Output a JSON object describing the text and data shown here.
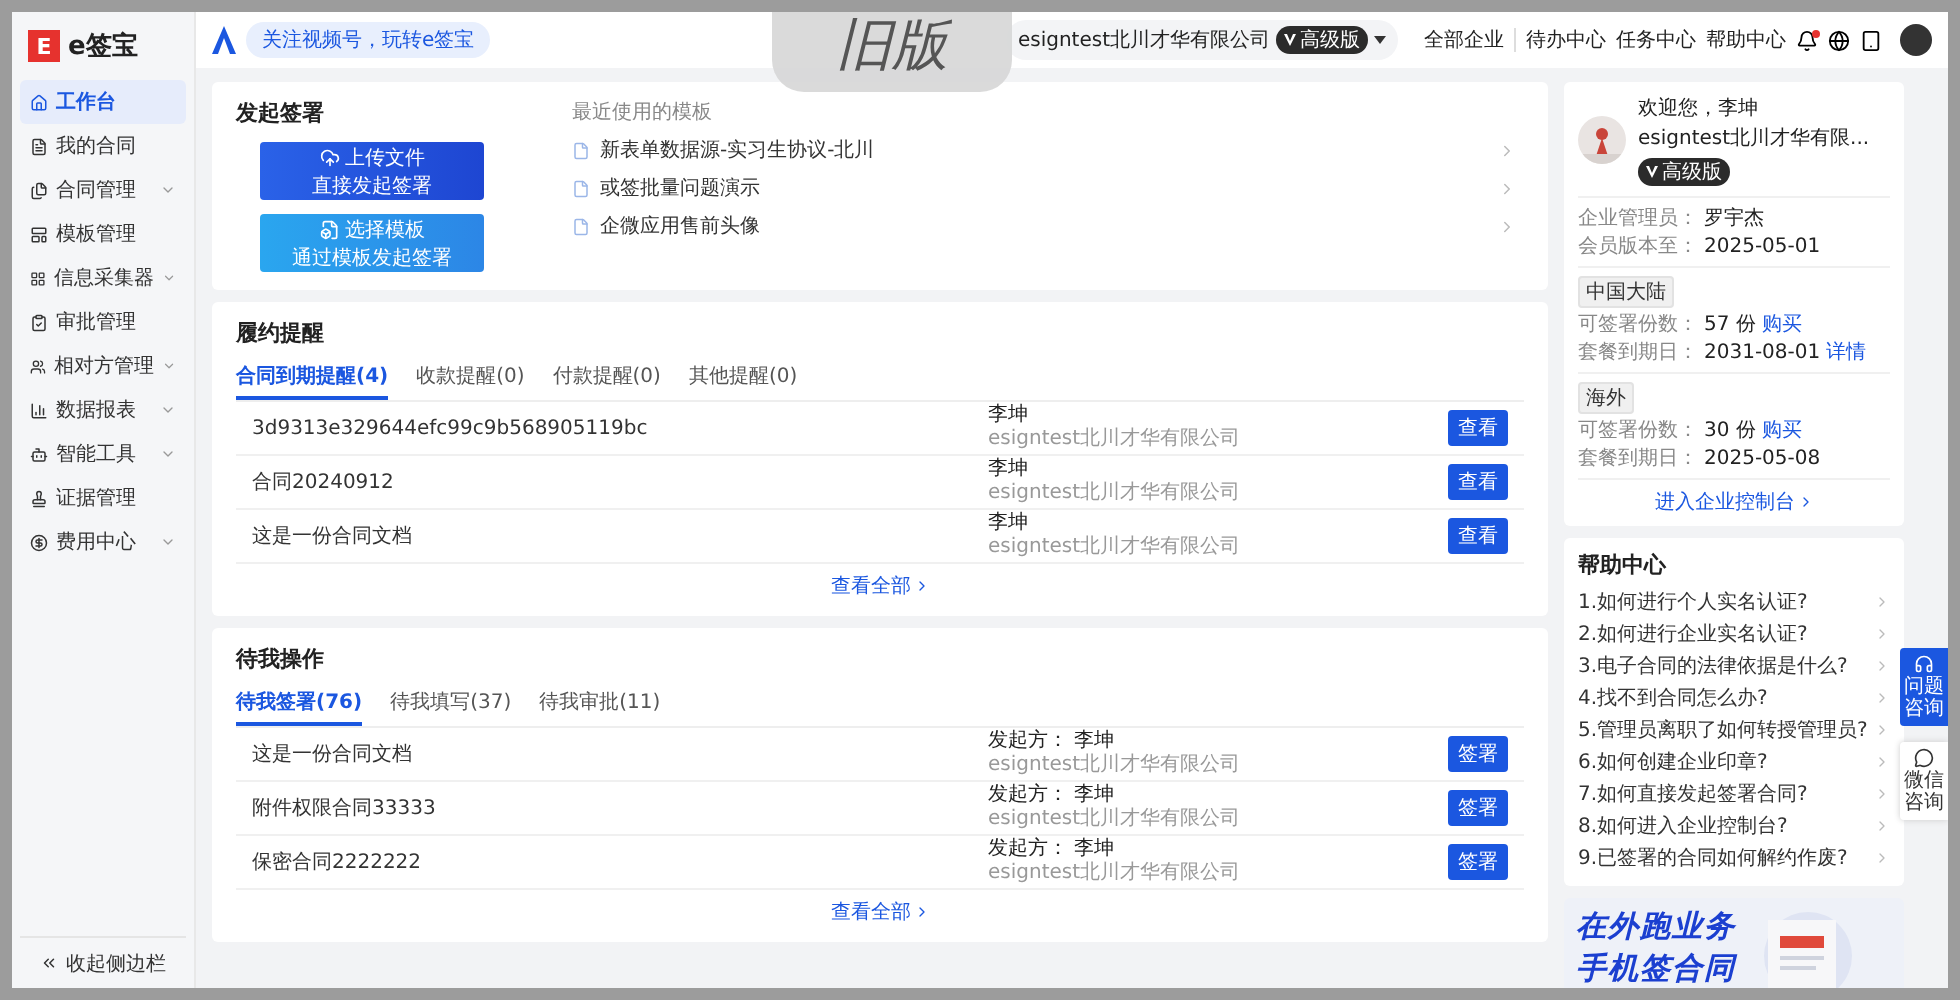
{
  "version_tag": "旧版",
  "sidebar": {
    "logo_mark": "E",
    "logo_text": "e签宝",
    "items": [
      {
        "label": "工作台",
        "selected": true,
        "expandable": false
      },
      {
        "label": "我的合同",
        "selected": false,
        "expandable": false
      },
      {
        "label": "合同管理",
        "selected": false,
        "expandable": true
      },
      {
        "label": "模板管理",
        "selected": false,
        "expandable": false
      },
      {
        "label": "信息采集器",
        "selected": false,
        "expandable": true
      },
      {
        "label": "审批管理",
        "selected": false,
        "expandable": false
      },
      {
        "label": "相对方管理",
        "selected": false,
        "expandable": true
      },
      {
        "label": "数据报表",
        "selected": false,
        "expandable": true
      },
      {
        "label": "智能工具",
        "selected": false,
        "expandable": true
      },
      {
        "label": "证据管理",
        "selected": false,
        "expandable": false
      },
      {
        "label": "费用中心",
        "selected": false,
        "expandable": true
      }
    ],
    "collapse": "收起侧边栏"
  },
  "header": {
    "promo": "关注视频号，玩转e签宝",
    "company": "esigntest北川才华有限公司",
    "badge": "高级版",
    "nav": [
      "全部企业",
      "待办中心",
      "任务中心",
      "帮助中心"
    ],
    "notification_dot": true
  },
  "start_sign": {
    "title": "发起签署",
    "actions": [
      {
        "kind": "upload",
        "label": "上传文件",
        "sub": "直接发起签署"
      },
      {
        "kind": "template",
        "label": "选择模板",
        "sub": "通过模板发起签署"
      }
    ],
    "recent_title": "最近使用的模板",
    "recent": [
      "新表单数据源-实习生协议-北川",
      "或签批量问题演示",
      "企微应用售前头像"
    ]
  },
  "reminders": {
    "title": "履约提醒",
    "tabs": [
      {
        "label": "合同到期提醒(4)",
        "selected": true
      },
      {
        "label": "收款提醒(0)",
        "selected": false
      },
      {
        "label": "付款提醒(0)",
        "selected": false
      },
      {
        "label": "其他提醒(0)",
        "selected": false
      }
    ],
    "rows": [
      {
        "name": "3d9313e329644efc99c9b568905119bc",
        "person": "李坤",
        "company": "esigntest北川才华有限公司",
        "action": "查看"
      },
      {
        "name": "合同20240912",
        "person": "李坤",
        "company": "esigntest北川才华有限公司",
        "action": "查看"
      },
      {
        "name": "这是一份合同文档",
        "person": "李坤",
        "company": "esigntest北川才华有限公司",
        "action": "查看"
      }
    ],
    "view_all": "查看全部"
  },
  "todo": {
    "title": "待我操作",
    "tabs": [
      {
        "label": "待我签署(76)",
        "selected": true
      },
      {
        "label": "待我填写(37)",
        "selected": false
      },
      {
        "label": "待我审批(11)",
        "selected": false
      }
    ],
    "rows": [
      {
        "name": "这是一份合同文档",
        "initiator_label": "发起方：",
        "person": "李坤",
        "company": "esigntest北川才华有限公司",
        "action": "签署"
      },
      {
        "name": "附件权限合同33333",
        "initiator_label": "发起方：",
        "person": "李坤",
        "company": "esigntest北川才华有限公司",
        "action": "签署"
      },
      {
        "name": "保密合同2222222",
        "initiator_label": "发起方：",
        "person": "李坤",
        "company": "esigntest北川才华有限公司",
        "action": "签署"
      }
    ],
    "view_all": "查看全部"
  },
  "account": {
    "welcome": "欢迎您，李坤",
    "company": "esigntest北川才华有限...",
    "badge": "高级版",
    "info": [
      {
        "label": "企业管理员：",
        "value": "罗宇杰"
      },
      {
        "label": "会员版本至：",
        "value": "2025-05-01"
      }
    ],
    "regions": [
      {
        "tag": "中国大陆",
        "lines": [
          {
            "label": "可签署份数：",
            "value": "57",
            "unit": "份",
            "link": "购买"
          },
          {
            "label": "套餐到期日：",
            "value": "2031-08-01",
            "link": "详情"
          }
        ]
      },
      {
        "tag": "海外",
        "lines": [
          {
            "label": "可签署份数：",
            "value": "30",
            "unit": "份",
            "link": "购买"
          },
          {
            "label": "套餐到期日：",
            "value": "2025-05-08"
          }
        ]
      }
    ],
    "console_link": "进入企业控制台"
  },
  "help": {
    "title": "帮助中心",
    "items": [
      "1.如何进行个人实名认证?",
      "2.如何进行企业实名认证?",
      "3.电子合同的法律依据是什么?",
      "4.找不到合同怎么办?",
      "5.管理员离职了如何转授管理员?",
      "6.如何创建企业印章?",
      "7.如何直接发起签署合同?",
      "8.如何进入企业控制台?",
      "9.已签署的合同如何解约作废?"
    ]
  },
  "banner": {
    "lines": [
      "在外跑业务",
      "手机签合同"
    ]
  },
  "float_buttons": [
    {
      "kind": "service",
      "label": "问题咨询"
    },
    {
      "kind": "wechat",
      "label": "微信咨询"
    }
  ]
}
